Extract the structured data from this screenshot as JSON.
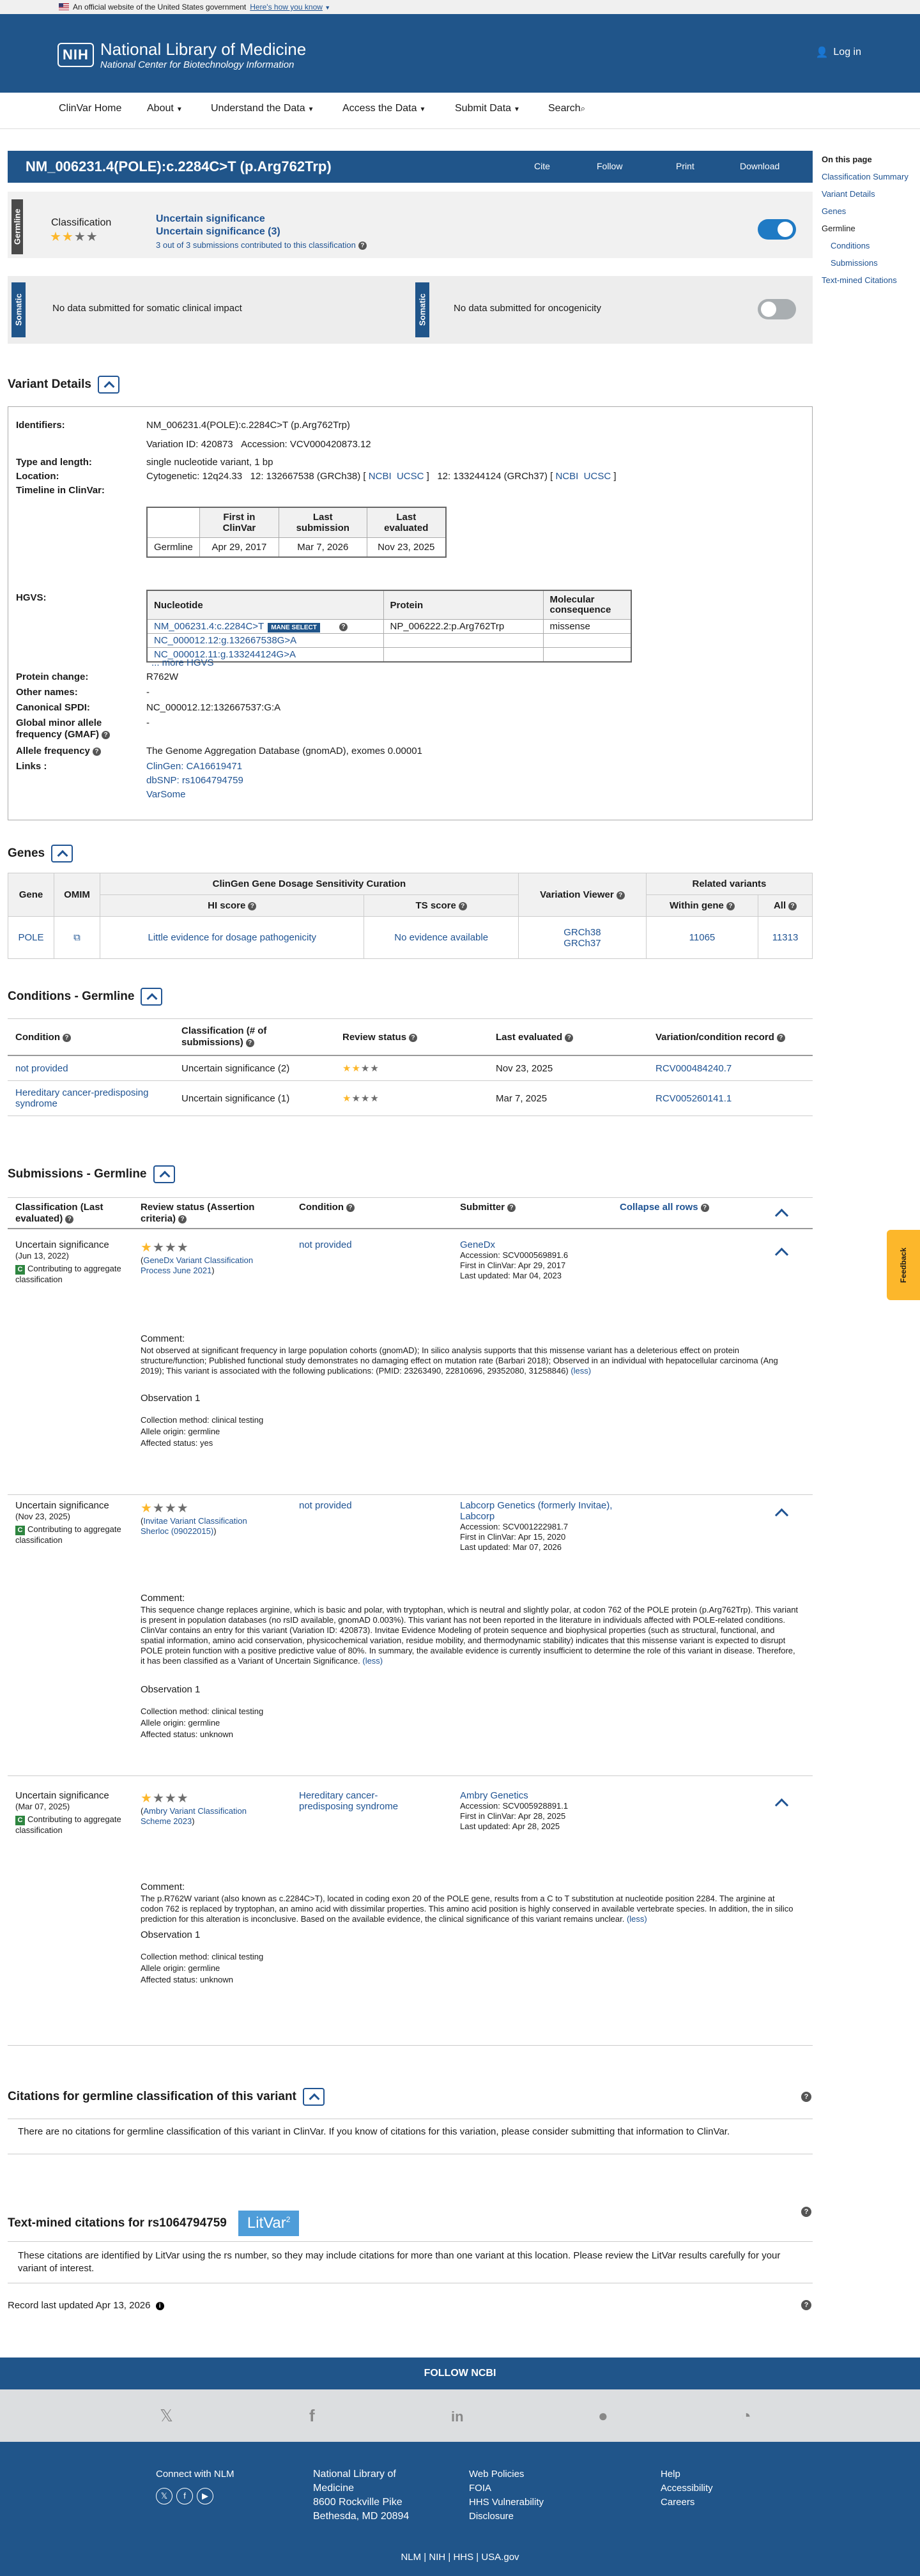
{
  "gov": {
    "text": "An official website of the United States government",
    "how": "Here's how you know"
  },
  "header": {
    "logo": "NIH",
    "title": "National Library of Medicine",
    "subtitle": "National Center for Biotechnology Information",
    "login": "Log in"
  },
  "nav": [
    "ClinVar Home",
    "About",
    "Understand the Data",
    "Access the Data",
    "Submit Data",
    "Search"
  ],
  "variant": {
    "title": "NM_006231.4(POLE):c.2284C>T (p.Arg762Trp)",
    "actions": [
      "Cite",
      "Follow",
      "Print",
      "Download"
    ]
  },
  "germline": {
    "side": "Germline",
    "class_label": "Classification",
    "sig1": "Uncertain significance",
    "sig2": "Uncertain significance (3)",
    "subs": "3 out of 3 submissions contributed to this classification"
  },
  "somatic": {
    "side": "Somatic",
    "clinical": "No data submitted for somatic clinical impact",
    "onco": "No data submitted for oncogenicity"
  },
  "details": {
    "heading": "Variant Details",
    "identifiers_label": "Identifiers:",
    "identifiers": "NM_006231.4(POLE):c.2284C>T (p.Arg762Trp)",
    "variation_id": "Variation ID: 420873",
    "accession": "Accession: VCV000420873.12",
    "type_label": "Type and length:",
    "type": "single nucleotide variant, 1 bp",
    "location_label": "Location:",
    "cyto": "Cytogenetic: 12q24.33",
    "grch38": "12: 132667538 (GRCh38)",
    "grch37": "12: 133244124 (GRCh37)",
    "ncbi": "NCBI",
    "ucsc": "UCSC",
    "timeline_label": "Timeline in ClinVar:",
    "timeline_head": [
      "First in ClinVar",
      "Last submission",
      "Last evaluated"
    ],
    "timeline_row": [
      "Germline",
      "Apr 29, 2017",
      "Mar 7, 2026",
      "Nov 23, 2025"
    ],
    "hgvs_label": "HGVS:",
    "hgvs_head": [
      "Nucleotide",
      "Protein",
      "Molecular consequence"
    ],
    "hgvs_rows": [
      [
        "NM_006231.4:c.2284C>T",
        "NP_006222.2:p.Arg762Trp",
        "missense"
      ],
      [
        "NC_000012.12:g.132667538G>A",
        "",
        ""
      ],
      [
        "NC_000012.11:g.133244124G>A",
        "",
        ""
      ]
    ],
    "mane": "MANE SELECT",
    "more_hgvs": "... more HGVS",
    "protein_label": "Protein change:",
    "protein": "R762W",
    "other_label": "Other names:",
    "other": "-",
    "spdi_label": "Canonical SPDI:",
    "spdi": "NC_000012.12:132667537:G:A",
    "gmaf_label": "Global minor allele frequency (GMAF)",
    "gmaf": "-",
    "af_label": "Allele frequency",
    "af": "The Genome Aggregation Database (gnomAD), exomes 0.00001",
    "links_label": "Links :",
    "links": [
      "ClinGen: CA16619471",
      "dbSNP: rs1064794759",
      "VarSome"
    ]
  },
  "genes": {
    "heading": "Genes",
    "h_gene": "Gene",
    "h_omim": "OMIM",
    "h_clingen": "ClinGen Gene Dosage Sensitivity Curation",
    "h_hi": "HI score",
    "h_ts": "TS score",
    "h_viewer": "Variation Viewer",
    "h_related": "Related variants",
    "h_within": "Within gene",
    "h_all": "All",
    "row": {
      "gene": "POLE",
      "hi": "Little evidence for dosage pathogenicity",
      "ts": "No evidence available",
      "v38": "GRCh38",
      "v37": "GRCh37",
      "within": "11065",
      "all": "11313"
    }
  },
  "conditions": {
    "heading": "Conditions - Germline",
    "head": [
      "Condition",
      "Classification (# of submissions)",
      "Review status",
      "Last evaluated",
      "Variation/condition record"
    ],
    "rows": [
      {
        "cond": "not provided",
        "cls": "Uncertain significance (2)",
        "date": "Nov 23, 2025",
        "rec": "RCV000484240.7",
        "stars": 2
      },
      {
        "cond": "Hereditary cancer-predisposing syndrome",
        "cls": "Uncertain significance (1)",
        "date": "Mar 7, 2025",
        "rec": "RCV005260141.1",
        "stars": 1
      }
    ]
  },
  "submissions": {
    "heading": "Submissions - Germline",
    "head": [
      "Classification (Last evaluated)",
      "Review status (Assertion criteria)",
      "Condition",
      "Submitter",
      "Collapse all rows"
    ],
    "contrib": "Contributing to aggregate classification",
    "comment": "Comment:",
    "obs": "Observation 1",
    "less": "(less)",
    "items": [
      {
        "cls": "Uncertain significance",
        "date": "(Jun 13, 2022)",
        "criteria": "GeneDx Variant Classification Process June 2021",
        "cond": "not provided",
        "sub": "GeneDx",
        "acc": "Accession: SCV000569891.6",
        "first": "First in ClinVar: Apr 29, 2017",
        "upd": "Last updated: Mar 04, 2023",
        "text": "Not observed at significant frequency in large population cohorts (gnomAD); In silico analysis supports that this missense variant has a deleterious effect on protein structure/function; Published functional study demonstrates no damaging effect on mutation rate (Barbari 2018); Observed in an individual with hepatocellular carcinoma (Ang 2019); This variant is associated with the following publications: (PMID: 23263490, 22810696, 29352080, 31258846)",
        "m": "Collection method: clinical testing",
        "a": "Allele origin: germline",
        "s": "Affected status: yes"
      },
      {
        "cls": "Uncertain significance",
        "date": "(Nov 23, 2025)",
        "criteria": "Invitae Variant Classification Sherloc (09022015)",
        "cond": "not provided",
        "sub": "Labcorp Genetics (formerly Invitae), Labcorp",
        "acc": "Accession: SCV001222981.7",
        "first": "First in ClinVar: Apr 15, 2020",
        "upd": "Last updated: Mar 07, 2026",
        "text": "This sequence change replaces arginine, which is basic and polar, with tryptophan, which is neutral and slightly polar, at codon 762 of the POLE protein (p.Arg762Trp). This variant is present in population databases (no rsID available, gnomAD 0.003%). This variant has not been reported in the literature in individuals affected with POLE-related conditions. ClinVar contains an entry for this variant (Variation ID: 420873). Invitae Evidence Modeling of protein sequence and biophysical properties (such as structural, functional, and spatial information, amino acid conservation, physicochemical variation, residue mobility, and thermodynamic stability) indicates that this missense variant is expected to disrupt POLE protein function with a positive predictive value of 80%. In summary, the available evidence is currently insufficient to determine the role of this variant in disease. Therefore, it has been classified as a Variant of Uncertain Significance.",
        "m": "Collection method: clinical testing",
        "a": "Allele origin: germline",
        "s": "Affected status: unknown"
      },
      {
        "cls": "Uncertain significance",
        "date": "(Mar 07, 2025)",
        "criteria": "Ambry Variant Classification Scheme 2023",
        "cond": "Hereditary cancer-predisposing syndrome",
        "sub": "Ambry Genetics",
        "acc": "Accession: SCV005928891.1",
        "first": "First in ClinVar: Apr 28, 2025",
        "upd": "Last updated: Apr 28, 2025",
        "text": "The p.R762W variant (also known as c.2284C>T), located in coding exon 20 of the POLE gene, results from a C to T substitution at nucleotide position 2284. The arginine at codon 762 is replaced by tryptophan, an amino acid with dissimilar properties. This amino acid position is highly conserved in available vertebrate species. In addition, the in silico prediction for this alteration is inconclusive. Based on the available evidence, the clinical significance of this variant remains unclear.",
        "m": "Collection method: clinical testing",
        "a": "Allele origin: germline",
        "s": "Affected status: unknown"
      }
    ]
  },
  "citations": {
    "heading": "Citations for germline classification of this variant",
    "text": "There are no citations for germline classification of this variant in ClinVar. If you know of citations for this variation, please consider submitting that information to ClinVar."
  },
  "textmined": {
    "heading": "Text-mined citations for rs1064794759",
    "litvar": "LitVar",
    "litvar_sup": "2",
    "text": "These citations are identified by LitVar using the rs number, so they may include citations for more than one variant at this location. Please review the LitVar results carefully for your variant of interest."
  },
  "record": "Record last updated Apr 13, 2026",
  "onpage": {
    "title": "On this page",
    "items": [
      "Classification Summary",
      "Variant Details",
      "Genes",
      "Germline",
      "Conditions",
      "Submissions",
      "Text-mined Citations"
    ]
  },
  "feedback": "Feedback",
  "footer": {
    "follow": "FOLLOW NCBI",
    "connect": "Connect with NLM",
    "nlm": [
      "National Library of",
      "Medicine",
      "8600 Rockville Pike",
      "Bethesda, MD 20894"
    ],
    "col3": [
      "Web Policies",
      "FOIA",
      "HHS Vulnerability",
      "Disclosure"
    ],
    "col4": [
      "Help",
      "Accessibility",
      "Careers"
    ],
    "bottom": [
      "NLM",
      "NIH",
      "HHS",
      "USA.gov"
    ]
  },
  "colors": {
    "primary": "#20558a",
    "link": "#205493",
    "star": "#fcb72b",
    "toggle_on": "#1f7ac4",
    "contrib": "#2e8540"
  }
}
